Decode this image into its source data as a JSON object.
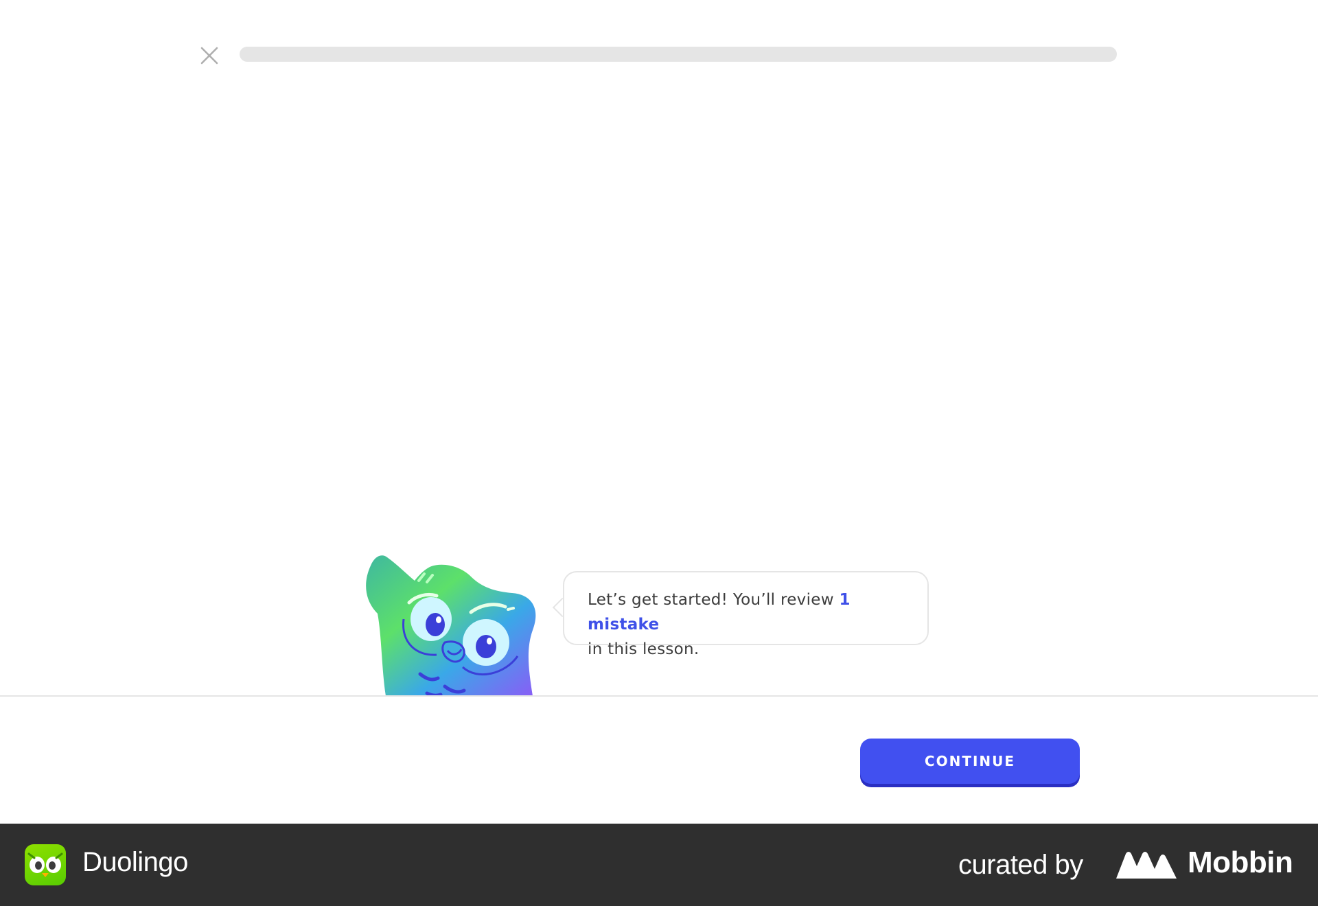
{
  "lesson": {
    "close_icon": "close-icon",
    "progress": 0
  },
  "mascot": {
    "icon": "duo-owl-mascot"
  },
  "bubble": {
    "text_before": "Let’s get started! You’ll review ",
    "highlight": "1 mistake",
    "text_after": "in this lesson."
  },
  "footer": {
    "continue_label": "CONTINUE"
  },
  "brand_bar": {
    "app_name": "Duolingo",
    "curated_label": "curated by",
    "curator_name": "Mobbin"
  },
  "colors": {
    "accent": "#4150f0",
    "highlight": "#3f51e8",
    "brand_bar": "#2f2f2f",
    "duolingo_green": "#58cc02"
  }
}
